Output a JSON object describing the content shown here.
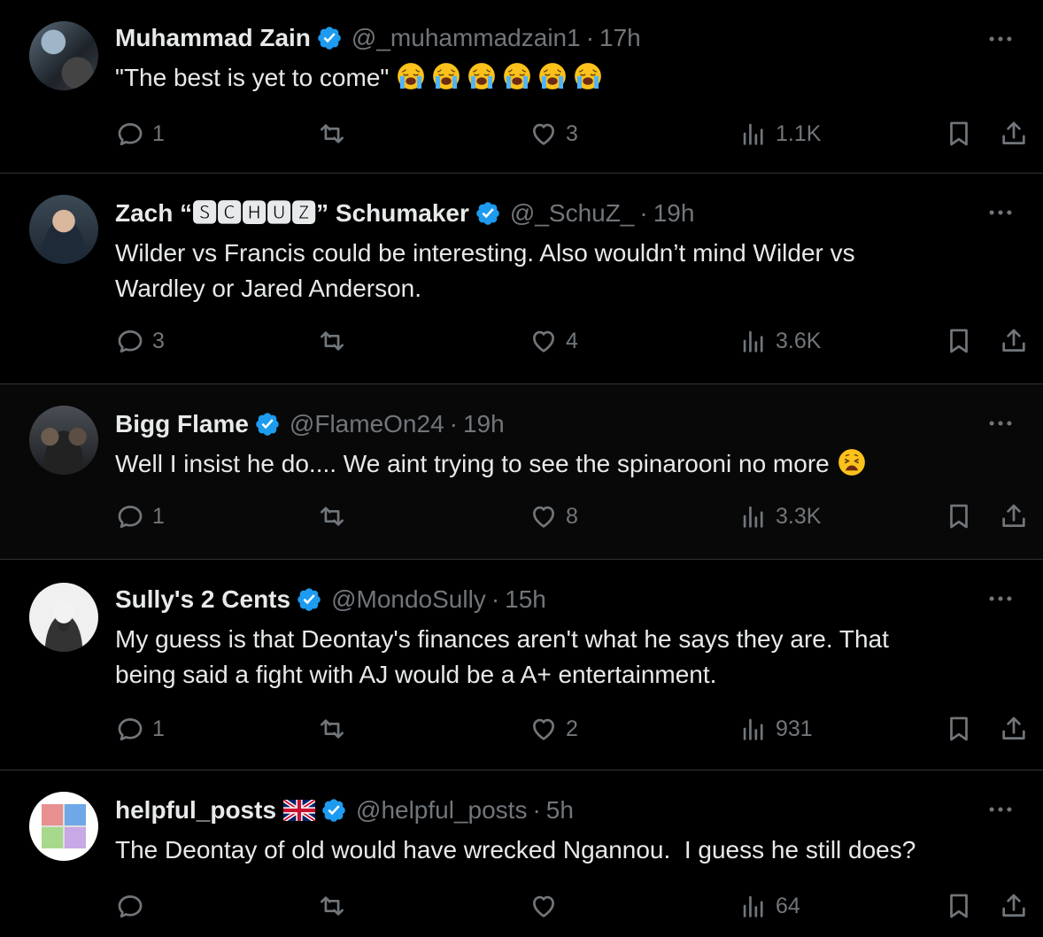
{
  "tweets": [
    {
      "name": "Muhammad Zain",
      "handle": "@_muhammadzain1",
      "time": "17h",
      "verified": true,
      "text": "\"The best is yet to come\"",
      "emojis": [
        "loudly-crying-face",
        "loudly-crying-face",
        "loudly-crying-face",
        "loudly-crying-face",
        "loudly-crying-face",
        "loudly-crying-face"
      ],
      "replies": "1",
      "retweets": "",
      "likes": "3",
      "views": "1.1K"
    },
    {
      "name": "Zach “🆂🅲🅷🆄🆉” Schumaker",
      "handle": "@_SchuZ_",
      "time": "19h",
      "verified": true,
      "text_line1": "Wilder vs Francis could be interesting. Also wouldn’t mind Wilder vs",
      "text_line2": "Wardley or Jared Anderson.",
      "replies": "3",
      "retweets": "",
      "likes": "4",
      "views": "3.6K"
    },
    {
      "name": "Bigg Flame",
      "handle": "@FlameOn24",
      "time": "19h",
      "verified": true,
      "text": "Well I insist he do.... We aint trying to see the spinarooni no more",
      "emojis": [
        "weary-face"
      ],
      "replies": "1",
      "retweets": "",
      "likes": "8",
      "views": "3.3K"
    },
    {
      "name": "Sully's 2 Cents",
      "handle": "@MondoSully",
      "time": "15h",
      "verified": true,
      "text_line1": "My guess is that Deontay's finances aren't what he says they are. That",
      "text_line2": "being said a fight with AJ would be a A+ entertainment.",
      "replies": "1",
      "retweets": "",
      "likes": "2",
      "views": "931"
    },
    {
      "name": "helpful_posts",
      "handle": "@helpful_posts",
      "time": "5h",
      "verified": true,
      "flag": "uk-flag-icon",
      "text": "The Deontay of old would have wrecked Ngannou.  I guess he still does?",
      "replies": "",
      "retweets": "",
      "likes": "",
      "views": "64"
    }
  ],
  "separator": "·",
  "colors": {
    "background": "#000000",
    "text": "#e7e9ea",
    "muted": "#71767b",
    "verified": "#1d9bf0",
    "divider": "#2f3336"
  }
}
